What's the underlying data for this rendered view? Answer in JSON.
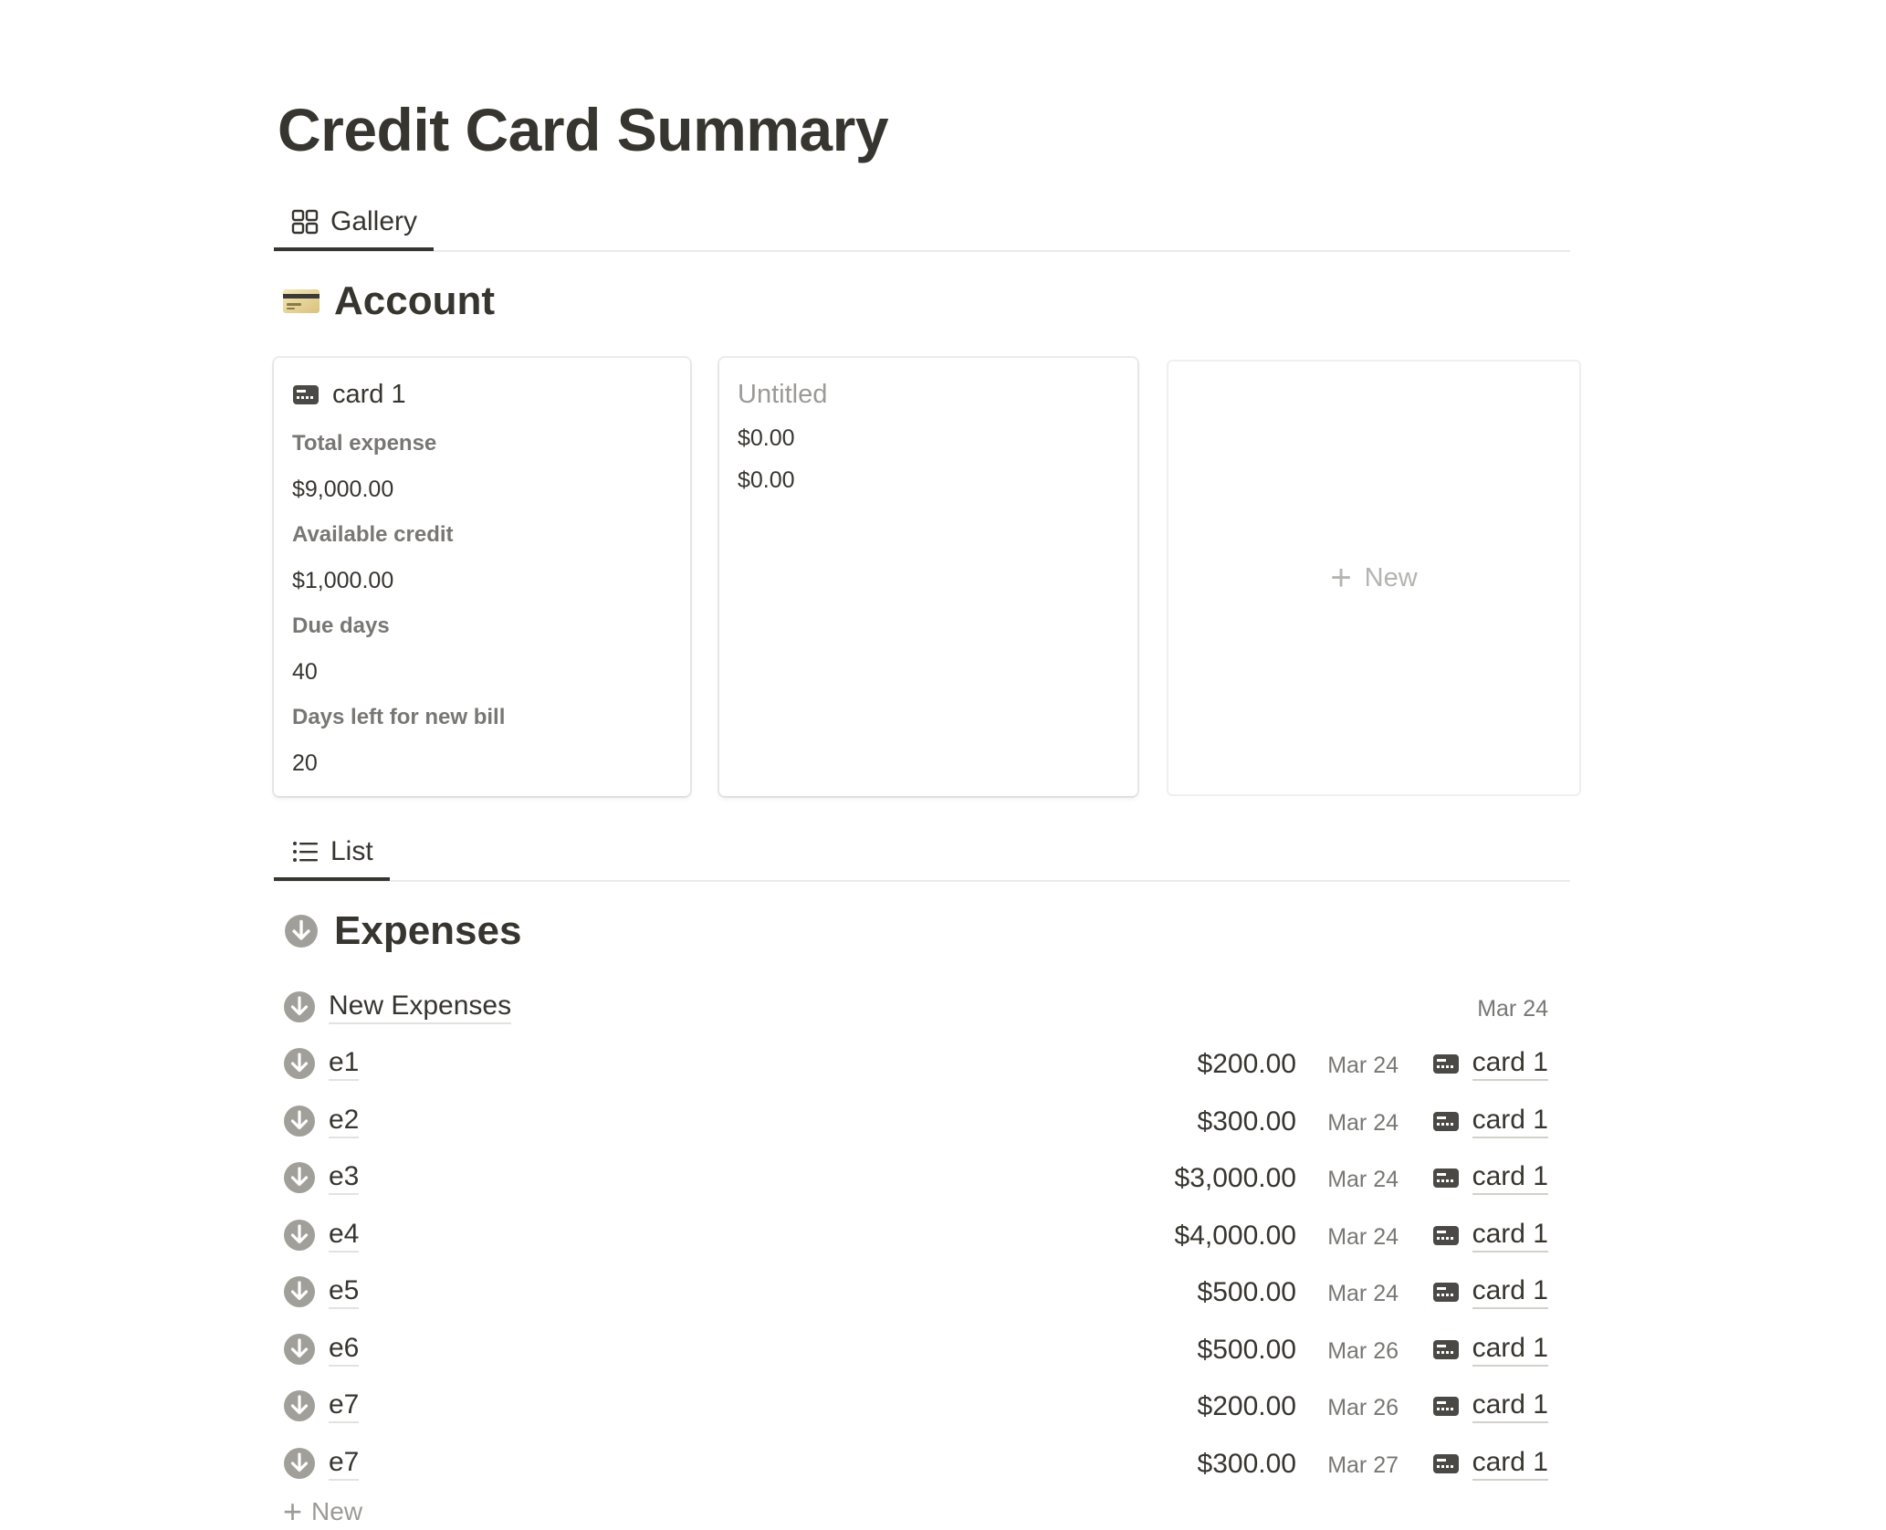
{
  "page": {
    "title": "Credit Card Summary"
  },
  "gallery_view": {
    "tab_label": "Gallery",
    "section_title": "Account",
    "cards": [
      {
        "title": "card 1",
        "props": [
          {
            "label": "Total expense",
            "value": "$9,000.00"
          },
          {
            "label": "Available credit",
            "value": "$1,000.00"
          },
          {
            "label": "Due days",
            "value": "40"
          },
          {
            "label": "Days left for new bill",
            "value": "20"
          }
        ]
      },
      {
        "title": "Untitled",
        "values": [
          "$0.00",
          "$0.00"
        ]
      }
    ],
    "new_card_label": "New"
  },
  "list_view": {
    "tab_label": "List",
    "section_title": "Expenses",
    "header_row": {
      "name": "New Expenses",
      "date": "Mar 24"
    },
    "rows": [
      {
        "name": "e1",
        "amount": "$200.00",
        "date": "Mar 24",
        "card": "card 1"
      },
      {
        "name": "e2",
        "amount": "$300.00",
        "date": "Mar 24",
        "card": "card 1"
      },
      {
        "name": "e3",
        "amount": "$3,000.00",
        "date": "Mar 24",
        "card": "card 1"
      },
      {
        "name": "e4",
        "amount": "$4,000.00",
        "date": "Mar 24",
        "card": "card 1"
      },
      {
        "name": "e5",
        "amount": "$500.00",
        "date": "Mar 24",
        "card": "card 1"
      },
      {
        "name": "e6",
        "amount": "$500.00",
        "date": "Mar 26",
        "card": "card 1"
      },
      {
        "name": "e7",
        "amount": "$200.00",
        "date": "Mar 26",
        "card": "card 1"
      },
      {
        "name": "e7",
        "amount": "$300.00",
        "date": "Mar 27",
        "card": "card 1"
      }
    ],
    "new_label": "New"
  },
  "icons": {
    "gallery_tab": "gallery-grid-icon",
    "list_tab": "bullet-list-icon",
    "account_section": "credit-card-emoji-icon",
    "card": "card-icon",
    "expense": "arrow-down-circle-icon",
    "add": "plus-icon"
  },
  "colors": {
    "text": "#37352f",
    "muted": "#787774",
    "icon_gray": "#a19f99",
    "border": "#ebebea"
  }
}
